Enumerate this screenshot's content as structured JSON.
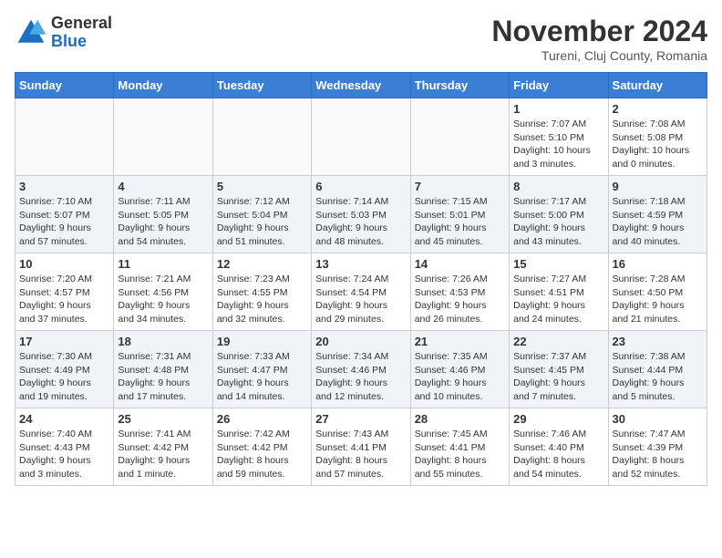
{
  "logo": {
    "general": "General",
    "blue": "Blue"
  },
  "title": "November 2024",
  "location": "Tureni, Cluj County, Romania",
  "days_of_week": [
    "Sunday",
    "Monday",
    "Tuesday",
    "Wednesday",
    "Thursday",
    "Friday",
    "Saturday"
  ],
  "weeks": [
    [
      {
        "day": "",
        "info": ""
      },
      {
        "day": "",
        "info": ""
      },
      {
        "day": "",
        "info": ""
      },
      {
        "day": "",
        "info": ""
      },
      {
        "day": "",
        "info": ""
      },
      {
        "day": "1",
        "info": "Sunrise: 7:07 AM\nSunset: 5:10 PM\nDaylight: 10 hours\nand 3 minutes."
      },
      {
        "day": "2",
        "info": "Sunrise: 7:08 AM\nSunset: 5:08 PM\nDaylight: 10 hours\nand 0 minutes."
      }
    ],
    [
      {
        "day": "3",
        "info": "Sunrise: 7:10 AM\nSunset: 5:07 PM\nDaylight: 9 hours\nand 57 minutes."
      },
      {
        "day": "4",
        "info": "Sunrise: 7:11 AM\nSunset: 5:05 PM\nDaylight: 9 hours\nand 54 minutes."
      },
      {
        "day": "5",
        "info": "Sunrise: 7:12 AM\nSunset: 5:04 PM\nDaylight: 9 hours\nand 51 minutes."
      },
      {
        "day": "6",
        "info": "Sunrise: 7:14 AM\nSunset: 5:03 PM\nDaylight: 9 hours\nand 48 minutes."
      },
      {
        "day": "7",
        "info": "Sunrise: 7:15 AM\nSunset: 5:01 PM\nDaylight: 9 hours\nand 45 minutes."
      },
      {
        "day": "8",
        "info": "Sunrise: 7:17 AM\nSunset: 5:00 PM\nDaylight: 9 hours\nand 43 minutes."
      },
      {
        "day": "9",
        "info": "Sunrise: 7:18 AM\nSunset: 4:59 PM\nDaylight: 9 hours\nand 40 minutes."
      }
    ],
    [
      {
        "day": "10",
        "info": "Sunrise: 7:20 AM\nSunset: 4:57 PM\nDaylight: 9 hours\nand 37 minutes."
      },
      {
        "day": "11",
        "info": "Sunrise: 7:21 AM\nSunset: 4:56 PM\nDaylight: 9 hours\nand 34 minutes."
      },
      {
        "day": "12",
        "info": "Sunrise: 7:23 AM\nSunset: 4:55 PM\nDaylight: 9 hours\nand 32 minutes."
      },
      {
        "day": "13",
        "info": "Sunrise: 7:24 AM\nSunset: 4:54 PM\nDaylight: 9 hours\nand 29 minutes."
      },
      {
        "day": "14",
        "info": "Sunrise: 7:26 AM\nSunset: 4:53 PM\nDaylight: 9 hours\nand 26 minutes."
      },
      {
        "day": "15",
        "info": "Sunrise: 7:27 AM\nSunset: 4:51 PM\nDaylight: 9 hours\nand 24 minutes."
      },
      {
        "day": "16",
        "info": "Sunrise: 7:28 AM\nSunset: 4:50 PM\nDaylight: 9 hours\nand 21 minutes."
      }
    ],
    [
      {
        "day": "17",
        "info": "Sunrise: 7:30 AM\nSunset: 4:49 PM\nDaylight: 9 hours\nand 19 minutes."
      },
      {
        "day": "18",
        "info": "Sunrise: 7:31 AM\nSunset: 4:48 PM\nDaylight: 9 hours\nand 17 minutes."
      },
      {
        "day": "19",
        "info": "Sunrise: 7:33 AM\nSunset: 4:47 PM\nDaylight: 9 hours\nand 14 minutes."
      },
      {
        "day": "20",
        "info": "Sunrise: 7:34 AM\nSunset: 4:46 PM\nDaylight: 9 hours\nand 12 minutes."
      },
      {
        "day": "21",
        "info": "Sunrise: 7:35 AM\nSunset: 4:46 PM\nDaylight: 9 hours\nand 10 minutes."
      },
      {
        "day": "22",
        "info": "Sunrise: 7:37 AM\nSunset: 4:45 PM\nDaylight: 9 hours\nand 7 minutes."
      },
      {
        "day": "23",
        "info": "Sunrise: 7:38 AM\nSunset: 4:44 PM\nDaylight: 9 hours\nand 5 minutes."
      }
    ],
    [
      {
        "day": "24",
        "info": "Sunrise: 7:40 AM\nSunset: 4:43 PM\nDaylight: 9 hours\nand 3 minutes."
      },
      {
        "day": "25",
        "info": "Sunrise: 7:41 AM\nSunset: 4:42 PM\nDaylight: 9 hours\nand 1 minute."
      },
      {
        "day": "26",
        "info": "Sunrise: 7:42 AM\nSunset: 4:42 PM\nDaylight: 8 hours\nand 59 minutes."
      },
      {
        "day": "27",
        "info": "Sunrise: 7:43 AM\nSunset: 4:41 PM\nDaylight: 8 hours\nand 57 minutes."
      },
      {
        "day": "28",
        "info": "Sunrise: 7:45 AM\nSunset: 4:41 PM\nDaylight: 8 hours\nand 55 minutes."
      },
      {
        "day": "29",
        "info": "Sunrise: 7:46 AM\nSunset: 4:40 PM\nDaylight: 8 hours\nand 54 minutes."
      },
      {
        "day": "30",
        "info": "Sunrise: 7:47 AM\nSunset: 4:39 PM\nDaylight: 8 hours\nand 52 minutes."
      }
    ]
  ]
}
